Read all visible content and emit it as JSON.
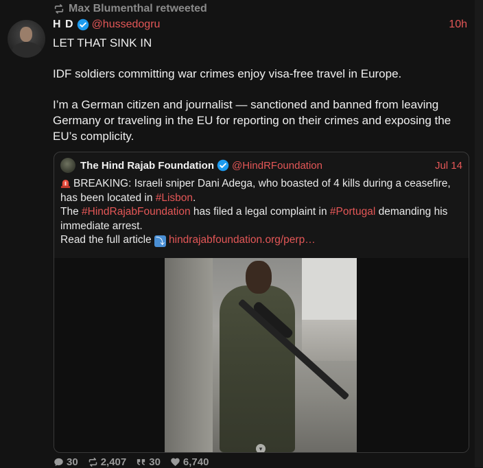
{
  "retweet": {
    "text": "Max Blumenthal retweeted"
  },
  "tweet": {
    "author_name": "H D",
    "handle": "@hussedogru",
    "time": "10h",
    "paragraphs": [
      "LET THAT SINK IN",
      "IDF soldiers committing war crimes enjoy visa-free travel in Europe.",
      "I’m a German citizen and journalist — sanctioned and banned from leaving Germany or traveling in the EU for reporting on their crimes and exposing the EU’s complicity."
    ]
  },
  "quote": {
    "author_name": "The Hind Rajab Foundation",
    "handle": "@HindRFoundation",
    "time": "Jul 14",
    "line1_prefix": "BREAKING: Israeli sniper Dani Adega, who boasted of 4 kills during a ceasefire, has been located in ",
    "line1_link": "#Lisbon",
    "line1_suffix": ".",
    "line2_a": "The ",
    "line2_link1": "#HindRajabFoundation",
    "line2_b": " has filed a legal complaint in ",
    "line2_link2": "#Portugal",
    "line2_c": " demanding his immediate arrest.",
    "line3_prefix": "Read the full article",
    "line3_link": "hindrajabfoundation.org/perp…"
  },
  "actions": {
    "replies": "30",
    "retweets": "2,407",
    "quotes": "30",
    "likes": "6,740"
  },
  "colors": {
    "background": "#131313",
    "accent": "#e45757",
    "verified": "#1d9bf0"
  }
}
